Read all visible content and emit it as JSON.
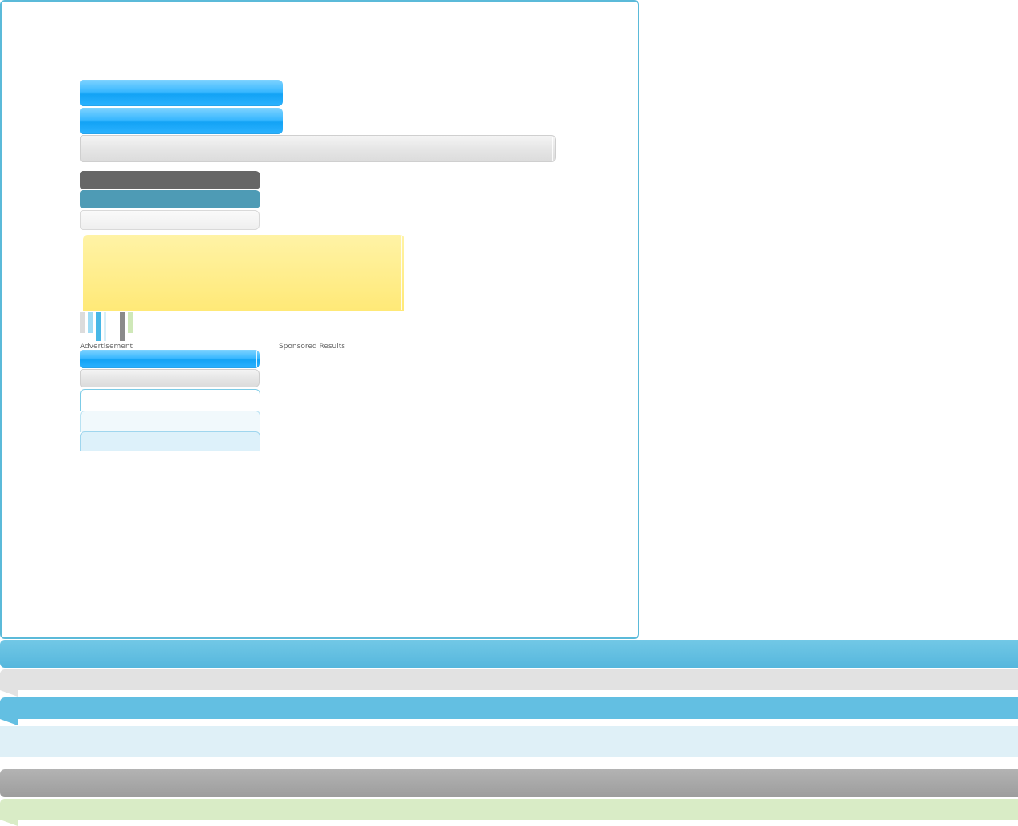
{
  "labels": {
    "advertisement": "Advertisement",
    "sponsored_results": "Sponsored Results"
  }
}
